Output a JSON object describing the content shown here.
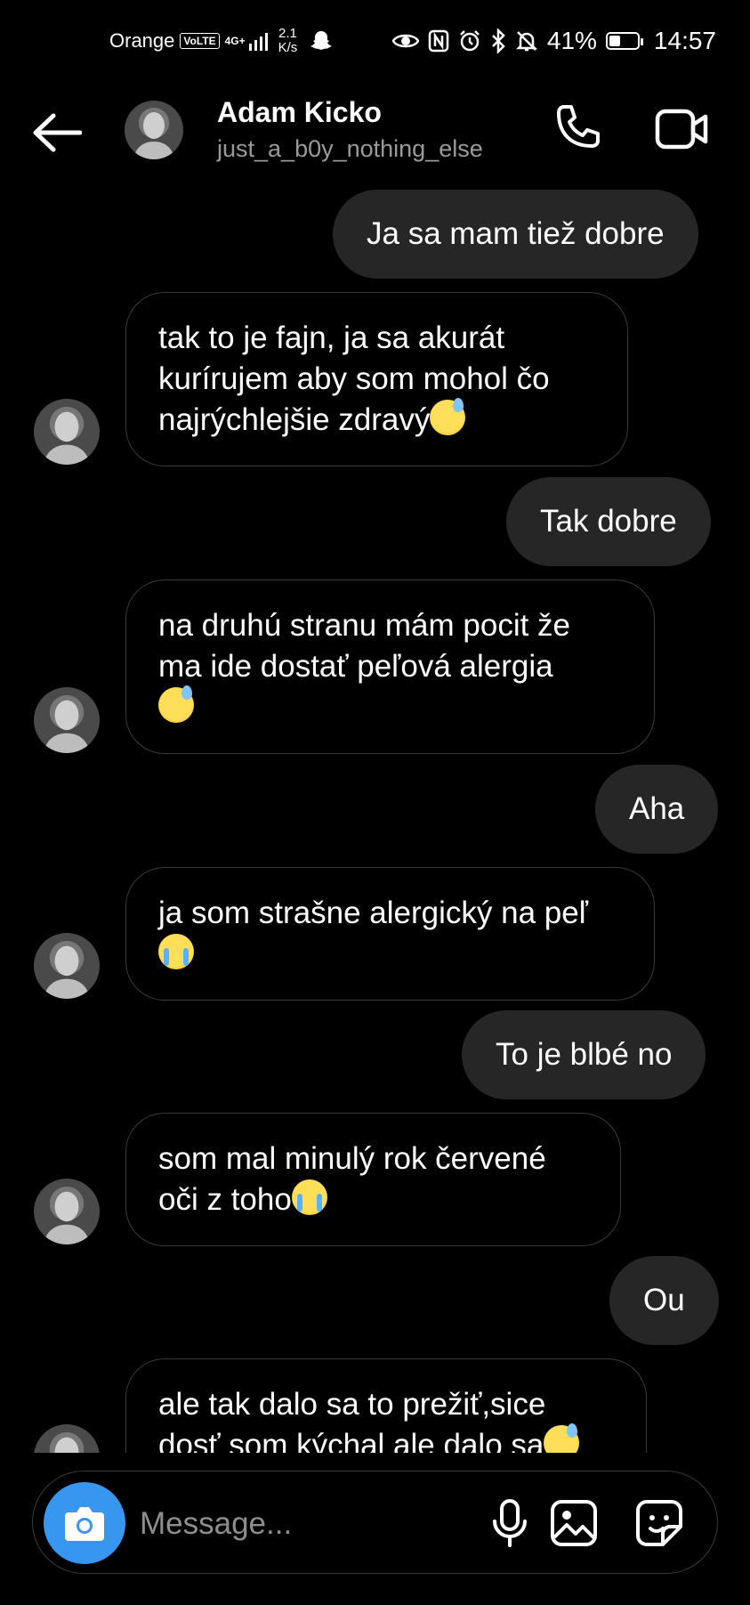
{
  "status_bar": {
    "carrier": "Orange",
    "volte": "VoLTE",
    "network": "4G+",
    "speed_value": "2.1",
    "speed_unit": "K/s",
    "battery": "41%",
    "battery_level": 0.41,
    "time": "14:57"
  },
  "header": {
    "name": "Adam Kicko",
    "username": "just_a_b0y_nothing_else"
  },
  "messages": [
    {
      "from": "me",
      "text": "Ja sa mam tiež dobre"
    },
    {
      "from": "them",
      "text": "tak to je fajn, ja sa akurát kurírujem aby som mohol čo najrýchlejšie zdravý",
      "emoji": "sweat-smile-icon"
    },
    {
      "from": "me",
      "text": "Tak dobre"
    },
    {
      "from": "them",
      "text": "na druhú stranu mám pocit že ma ide dostať peľová alergia",
      "emoji": "sweat-smile-icon"
    },
    {
      "from": "me",
      "text": "Aha"
    },
    {
      "from": "them",
      "text": "ja som strašne alergický na peľ",
      "emoji": "crying-face-icon"
    },
    {
      "from": "me",
      "text": "To je blbé no"
    },
    {
      "from": "them",
      "text": "som mal minulý rok červené oči z toho",
      "emoji": "crying-face-icon"
    },
    {
      "from": "me",
      "text": "Ou"
    },
    {
      "from": "them",
      "text": "ale tak dalo sa to prežiť,sice dosť som kýchal ale dalo sa",
      "emoji": "sweat-smile-icon"
    }
  ],
  "composer": {
    "placeholder": "Message..."
  },
  "colors": {
    "background": "#000000",
    "outgoing_bubble": "#262626",
    "incoming_border": "#3a3a3a",
    "camera_button": "#3797f0",
    "muted_text": "#9a9a9a"
  }
}
